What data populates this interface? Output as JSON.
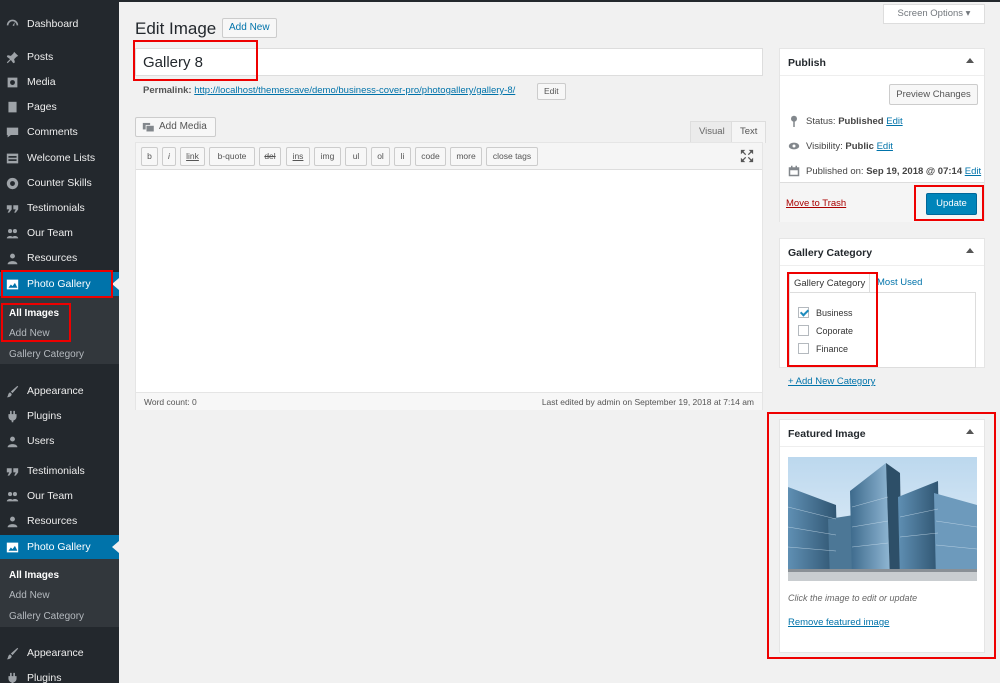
{
  "sidebar": {
    "items_top": [
      {
        "label": "Dashboard",
        "icon": "dashboard-icon"
      },
      {
        "label": "Posts",
        "icon": "pin-icon"
      },
      {
        "label": "Media",
        "icon": "media-icon"
      },
      {
        "label": "Pages",
        "icon": "pages-icon"
      },
      {
        "label": "Comments",
        "icon": "comments-icon"
      },
      {
        "label": "Welcome Lists",
        "icon": "list-icon"
      },
      {
        "label": "Counter Skills",
        "icon": "gauge-icon"
      },
      {
        "label": "Testimonials",
        "icon": "quote-icon"
      },
      {
        "label": "Our Team",
        "icon": "group-icon"
      },
      {
        "label": "Resources",
        "icon": "users-icon"
      },
      {
        "label": "Photo Gallery",
        "icon": "image-icon",
        "active": true
      }
    ],
    "sub_top": [
      "All Images",
      "Add New",
      "Gallery Category"
    ],
    "items_mid": [
      {
        "label": "Appearance",
        "icon": "brush-icon"
      },
      {
        "label": "Plugins",
        "icon": "plugin-icon"
      },
      {
        "label": "Users",
        "icon": "user-icon"
      },
      {
        "label": "Testimonials",
        "icon": "quote-icon"
      },
      {
        "label": "Our Team",
        "icon": "group-icon"
      },
      {
        "label": "Resources",
        "icon": "users-icon"
      },
      {
        "label": "Photo Gallery",
        "icon": "image-icon",
        "active": true
      }
    ],
    "sub_bottom": [
      "All Images",
      "Add New",
      "Gallery Category"
    ],
    "items_bottom": [
      {
        "label": "Appearance",
        "icon": "brush-icon"
      },
      {
        "label": "Plugins",
        "icon": "plugin-icon"
      }
    ]
  },
  "header": {
    "title": "Edit Image",
    "add_new": "Add New",
    "screen_options": "Screen Options ▾"
  },
  "post": {
    "title": "Gallery 8",
    "permalink_label": "Permalink:",
    "permalink_url": "http://localhost/themescave/demo/business-cover-pro/photogallery/gallery-8/",
    "permalink_edit": "Edit"
  },
  "editor": {
    "add_media": "Add Media",
    "tab_visual": "Visual",
    "tab_text": "Text",
    "quicktags": [
      "b",
      "i",
      "link",
      "b-quote",
      "del",
      "ins",
      "img",
      "ul",
      "ol",
      "li",
      "code",
      "more",
      "close tags"
    ],
    "word_count": "Word count: 0",
    "last_edited": "Last edited by admin on September 19, 2018 at 7:14 am"
  },
  "publish": {
    "title": "Publish",
    "preview": "Preview Changes",
    "status_label": "Status:",
    "status_value": "Published",
    "visibility_label": "Visibility:",
    "visibility_value": "Public",
    "published_label": "Published on:",
    "published_value": "Sep 19, 2018 @ 07:14",
    "edit": "Edit",
    "trash": "Move to Trash",
    "update": "Update"
  },
  "gallery_category": {
    "title": "Gallery Category",
    "tab_all": "Gallery Category",
    "tab_used": "Most Used",
    "items": [
      {
        "label": "Business",
        "checked": true
      },
      {
        "label": "Coporate",
        "checked": false
      },
      {
        "label": "Finance",
        "checked": false
      }
    ],
    "add_new": "+ Add New Category"
  },
  "featured": {
    "title": "Featured Image",
    "caption": "Click the image to edit or update",
    "remove": "Remove featured image"
  },
  "colors": {
    "sidebar": "#23282d",
    "accent": "#0073aa",
    "highlight": "#e00000",
    "button": "#0085ba"
  }
}
